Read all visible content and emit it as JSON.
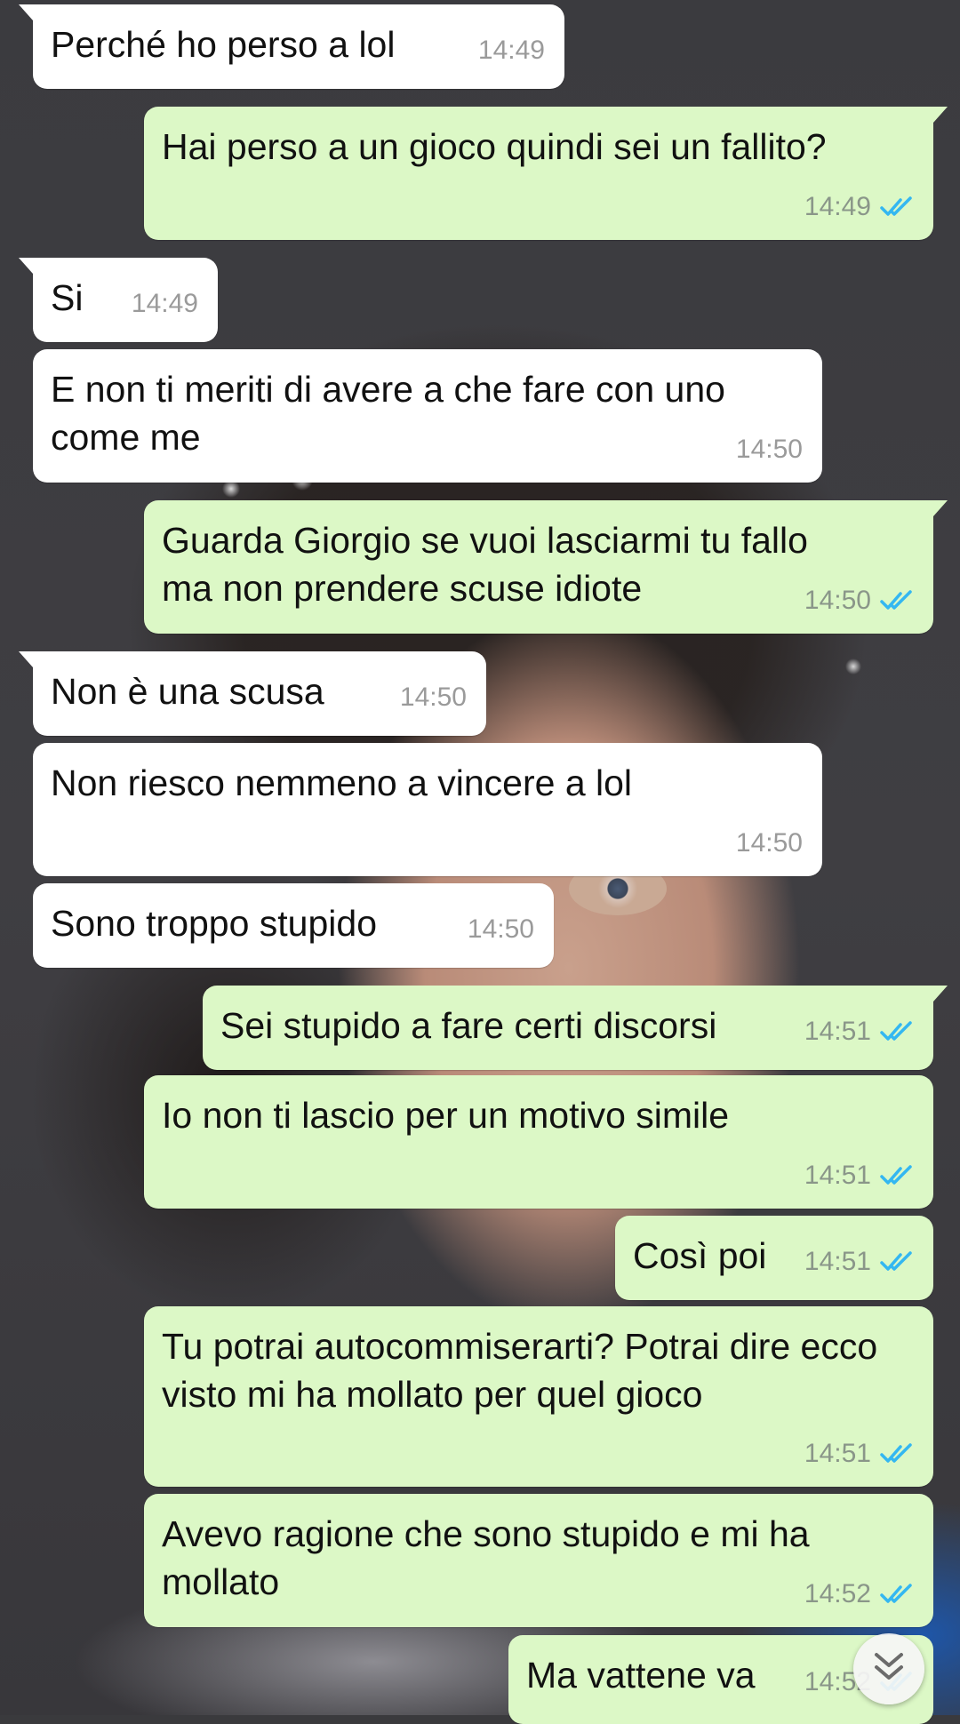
{
  "colors": {
    "incoming_bubble": "#ffffff",
    "outgoing_bubble": "#dcf8c6",
    "read_ticks": "#34b7f1"
  },
  "messages": [
    {
      "direction": "in",
      "text": "Perché ho perso a lol",
      "time": "14:49"
    },
    {
      "direction": "out",
      "text": "Hai perso a un gioco quindi sei un fallito?",
      "time": "14:49",
      "status": "read"
    },
    {
      "direction": "in",
      "text": "Si",
      "time": "14:49"
    },
    {
      "direction": "in",
      "text": "E non ti meriti di avere a che fare con uno come me",
      "time": "14:50"
    },
    {
      "direction": "out",
      "text": "Guarda Giorgio se vuoi lasciarmi tu fallo ma non prendere scuse idiote",
      "time": "14:50",
      "status": "read"
    },
    {
      "direction": "in",
      "text": "Non è una scusa",
      "time": "14:50"
    },
    {
      "direction": "in",
      "text": "Non riesco nemmeno a vincere a lol",
      "time": "14:50"
    },
    {
      "direction": "in",
      "text": "Sono troppo stupido",
      "time": "14:50"
    },
    {
      "direction": "out",
      "text": "Sei stupido a fare certi discorsi",
      "time": "14:51",
      "status": "read"
    },
    {
      "direction": "out",
      "text": "Io non ti lascio per un motivo simile",
      "time": "14:51",
      "status": "read"
    },
    {
      "direction": "out",
      "text": "Così poi",
      "time": "14:51",
      "status": "read"
    },
    {
      "direction": "out",
      "text": "Tu potrai autocommiserarti? Potrai dire ecco visto mi ha mollato per quel gioco",
      "time": "14:51",
      "status": "read"
    },
    {
      "direction": "out",
      "text": "Avevo ragione che sono stupido e mi ha mollato",
      "time": "14:52",
      "status": "read"
    },
    {
      "direction": "out",
      "text": "Ma vattene va",
      "time": "14:52",
      "status": "read"
    }
  ],
  "icons": {
    "read_receipt": "double-check-icon",
    "scroll_down": "double-chevron-down-icon"
  }
}
